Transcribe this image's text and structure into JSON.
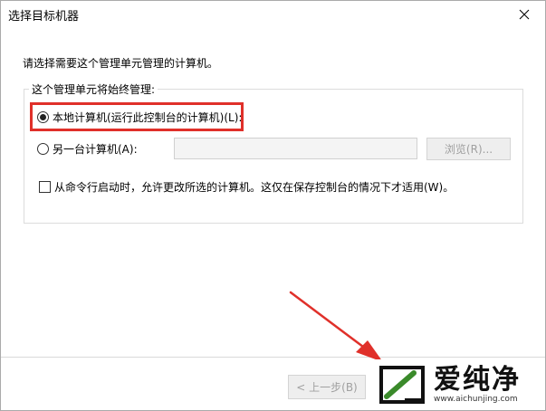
{
  "window": {
    "title": "选择目标机器",
    "close_label": "✕"
  },
  "instruction": "请选择需要这个管理单元管理的计算机。",
  "group": {
    "legend": "这个管理单元将始终管理:",
    "local_option": "本地计算机(运行此控制台的计算机)(L):",
    "local_selected": true,
    "other_option": "另一台计算机(A):",
    "other_selected": false,
    "computer_input_value": "",
    "browse_label": "浏览(R)...",
    "cmdline_label": "从命令行启动时，允许更改所选的计算机。这仅在保存控制台的情况下才适用(W)。",
    "cmdline_checked": false
  },
  "footer": {
    "prev_label": "< 上一步(B)"
  },
  "watermark": {
    "brand": "爱纯净",
    "url": "www.aichunjing.com"
  },
  "colors": {
    "highlight": "#e0302a",
    "arrow": "#e0302a",
    "logo_green": "#3a8a2a"
  }
}
